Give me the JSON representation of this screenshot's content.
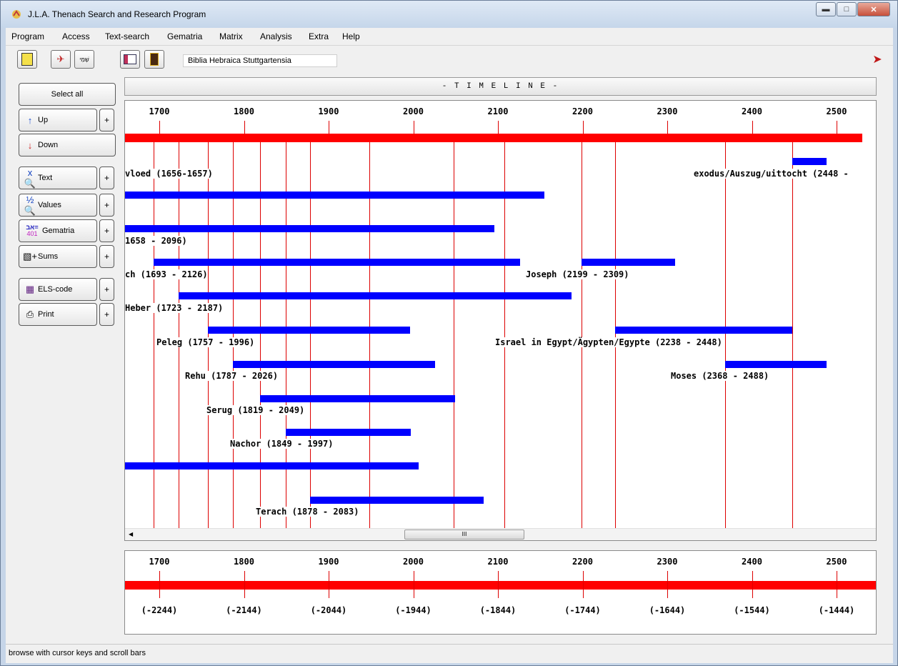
{
  "window": {
    "title": "J.L.A. Thenach Search and Research Program"
  },
  "menu": [
    "Program",
    "Access",
    "Text-search",
    "Gematria",
    "Matrix",
    "Analysis",
    "Extra",
    "Help"
  ],
  "toolbar": {
    "database": "Biblia Hebraica Stuttgartensia",
    "hebrew_label": "שְׁמֵי"
  },
  "sidebar": {
    "select_all": "Select all",
    "up": "Up",
    "down": "Down",
    "text": "Text",
    "values": "Values",
    "gematria": "Gematria",
    "gematria_icon_digits": "401",
    "sums": "Sums",
    "els_code": "ELS-code",
    "print": "Print",
    "plus": "+"
  },
  "timeline": {
    "header": "- T I M E L I N E -",
    "ticks": [
      "1700",
      "1800",
      "1900",
      "2000",
      "2100",
      "2200",
      "2300",
      "2400",
      "2500"
    ],
    "bc_ticks": [
      "(-2244)",
      "(-2144)",
      "(-2044)",
      "(-1944)",
      "(-1844)",
      "(-1744)",
      "(-1644)",
      "(-1544)",
      "(-1444)"
    ],
    "scroll_grip": "III",
    "entries": [
      {
        "label": "vloed (1656-1657)",
        "start": 1656,
        "end": 1657
      },
      {
        "label": "exodus/Auszug/uittocht (2448 -",
        "start": 2448,
        "end": 2488
      },
      {
        "label": "",
        "start": 1620,
        "end": 2155
      },
      {
        "label": "1658 - 2096)",
        "start": 1620,
        "end": 2096
      },
      {
        "label": "ch (1693 - 2126)",
        "start": 1693,
        "end": 2126
      },
      {
        "label": "Joseph (2199 - 2309)",
        "start": 2199,
        "end": 2309
      },
      {
        "label": "Heber (1723 - 2187)",
        "start": 1723,
        "end": 2187
      },
      {
        "label": "Peleg (1757 - 1996)",
        "start": 1757,
        "end": 1996
      },
      {
        "label": "Israel in Egypt/Ägypten/Egypte (2238 - 2448)",
        "start": 2238,
        "end": 2448
      },
      {
        "label": "Rehu (1787 - 2026)",
        "start": 1787,
        "end": 2026
      },
      {
        "label": "Moses (2368 - 2488)",
        "start": 2368,
        "end": 2488
      },
      {
        "label": "Serug (1819 - 2049)",
        "start": 1819,
        "end": 2049
      },
      {
        "label": "Nachor (1849 - 1997)",
        "start": 1849,
        "end": 1997
      },
      {
        "label": "",
        "start": 1620,
        "end": 2006
      },
      {
        "label": "Terach (1878 - 2083)",
        "start": 1878,
        "end": 2083
      }
    ],
    "markers": [
      1693,
      1723,
      1757,
      1787,
      1819,
      1849,
      1878,
      1948,
      2048,
      2108,
      2199,
      2238,
      2368,
      2448
    ]
  },
  "status": {
    "text": "browse with cursor keys and scroll bars"
  },
  "colors": {
    "timeline_bar": "#ff0000",
    "entry_bar": "#0000ff",
    "marker": "#dd0000"
  }
}
